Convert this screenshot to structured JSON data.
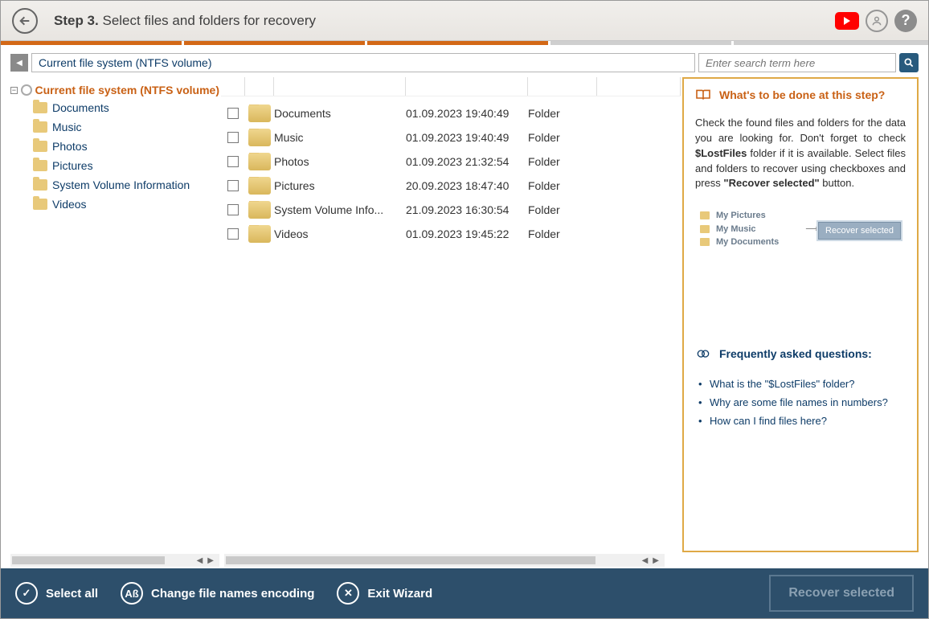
{
  "header": {
    "step_label": "Step 3.",
    "step_title": "Select files and folders for recovery"
  },
  "path": {
    "current": "Current file system (NTFS volume)"
  },
  "search": {
    "placeholder": "Enter search term here"
  },
  "tree": {
    "root_label": "Current file system (NTFS volume)",
    "items": [
      {
        "label": "Documents"
      },
      {
        "label": "Music"
      },
      {
        "label": "Photos"
      },
      {
        "label": "Pictures"
      },
      {
        "label": "System Volume Information"
      },
      {
        "label": "Videos"
      }
    ]
  },
  "filelist": {
    "rows": [
      {
        "name": "Documents",
        "date": "01.09.2023 19:40:49",
        "type": "Folder"
      },
      {
        "name": "Music",
        "date": "01.09.2023 19:40:49",
        "type": "Folder"
      },
      {
        "name": "Photos",
        "date": "01.09.2023 21:32:54",
        "type": "Folder"
      },
      {
        "name": "Pictures",
        "date": "20.09.2023 18:47:40",
        "type": "Folder"
      },
      {
        "name": "System Volume Info...",
        "date": "21.09.2023 16:30:54",
        "type": "Folder"
      },
      {
        "name": "Videos",
        "date": "01.09.2023 19:45:22",
        "type": "Folder"
      }
    ]
  },
  "help": {
    "title": "What's to be done at this step?",
    "text_parts": {
      "p1": "Check the found files and folders for the data you are looking for. Don't forget to check ",
      "bold1": "$LostFiles",
      "p2": " folder if it is available. Select files and folders to recover using checkboxes and press ",
      "bold2": "\"Recover selected\"",
      "p3": " button."
    },
    "illustration": {
      "item1": "My Pictures",
      "item2": "My Music",
      "item3": "My Documents",
      "chip": "Recover selected"
    },
    "faq_title": "Frequently asked questions:",
    "faq": [
      "What is the \"$LostFiles\" folder?",
      "Why are some file names in numbers?",
      "How can I find files here?"
    ]
  },
  "footer": {
    "select_all": "Select all",
    "encoding": "Change file names encoding",
    "exit": "Exit Wizard",
    "recover": "Recover selected"
  }
}
